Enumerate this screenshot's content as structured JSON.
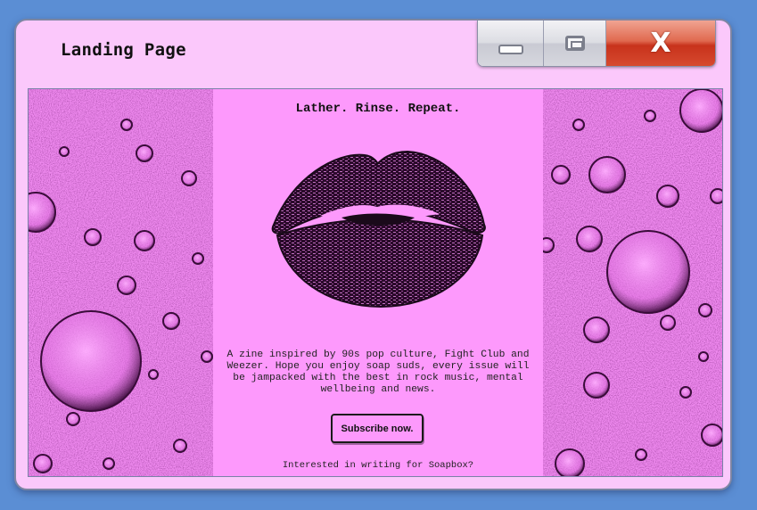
{
  "window": {
    "title": "Landing Page",
    "controls": {
      "minimize_icon": "minimize-icon",
      "maximize_icon": "maximize-icon",
      "close_icon": "close-icon",
      "close_glyph": "X"
    }
  },
  "page": {
    "headline": "Lather. Rinse. Repeat.",
    "description": "A zine inspired by 90s pop culture, Fight Club and Weezer. Hope you enjoy soap suds, every issue will be jampacked with the best in rock music, mental wellbeing and news.",
    "subscribe_label": "Subscribe now.",
    "writing_prompt": "Interested in writing for Soapbox?"
  },
  "colors": {
    "desktop": "#5b8ed4",
    "window": "#fbc8fb",
    "panel": "#fd99fc",
    "bubbles_bg": "#f08af0",
    "close_button": "#c8321c"
  },
  "decor": {
    "left_image": "bubbles-image",
    "right_image": "bubbles-image",
    "center_image": "lips-image"
  }
}
